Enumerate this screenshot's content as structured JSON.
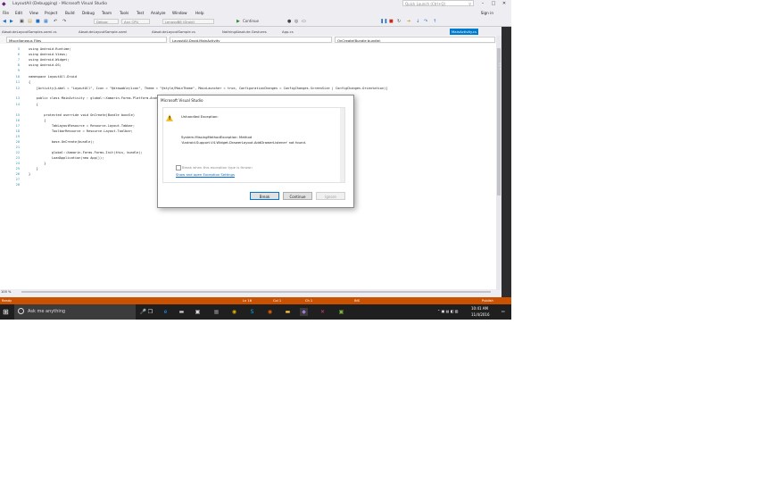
{
  "window": {
    "title": "LayoutAll (Debugging) - Microsoft Visual Studio",
    "quick_launch_placeholder": "Quick Launch (Ctrl+Q)",
    "sign_in": "Sign in"
  },
  "menu": [
    "File",
    "Edit",
    "View",
    "Project",
    "Build",
    "Debug",
    "Team",
    "Tools",
    "Test",
    "Analyze",
    "Window",
    "Help"
  ],
  "toolbar": {
    "config": "Debug",
    "platform": "Any CPU",
    "device": "LenovoB8 (Droid)",
    "continue_label": "Continue"
  },
  "doc_tabs": [
    {
      "label": "AbsoluteLayoutSamples.xaml.cs"
    },
    {
      "label": "AbsoluteLayoutSample.xaml"
    },
    {
      "label": "AbsoluteLayoutSample.cs"
    },
    {
      "label": "NothingAbsolute.Gestures"
    },
    {
      "label": "App.cs"
    },
    {
      "label": "MainActivity.cs"
    }
  ],
  "nav": {
    "project": "Miscellaneous Files",
    "type": "LayoutAll.Droid.MainActivity",
    "member": "OnCreate(Bundle bundle)"
  },
  "code_lines": [
    {
      "n": "5",
      "t": "using Android.Runtime;"
    },
    {
      "n": "6",
      "t": "using Android.Views;"
    },
    {
      "n": "7",
      "t": "using Android.Widget;"
    },
    {
      "n": "8",
      "t": "using Android.OS;"
    },
    {
      "n": "9",
      "t": ""
    },
    {
      "n": "10",
      "t": "namespace LayoutAll.Droid"
    },
    {
      "n": "11",
      "t": "{"
    },
    {
      "n": "12",
      "t": "    [Activity(Label = \"LayoutAll\", Icon = \"@drawable/icon\", Theme = \"@style/MainTheme\", MainLauncher = true, ConfigurationChanges = ConfigChanges.ScreenSize | ConfigChanges.Orientation)]"
    },
    {
      "n": "13",
      "t": "    public class MainActivity : global::Xamarin.Forms.Platform.Android.FormsAppCompatActivity"
    },
    {
      "n": "14",
      "t": "    {"
    },
    {
      "n": "15",
      "t": "        protected override void OnCreate(Bundle bundle)"
    },
    {
      "n": "16",
      "t": "        {"
    },
    {
      "n": "17",
      "t": "            TabLayoutResource = Resource.Layout.Tabbar;"
    },
    {
      "n": "18",
      "t": "            ToolbarResource = Resource.Layout.Toolbar;"
    },
    {
      "n": "19",
      "t": ""
    },
    {
      "n": "20",
      "t": "            base.OnCreate(bundle);"
    },
    {
      "n": "21",
      "t": ""
    },
    {
      "n": "22",
      "t": "            global::Xamarin.Forms.Forms.Init(this, bundle);"
    },
    {
      "n": "23",
      "t": "            LoadApplication(new App());"
    },
    {
      "n": "24",
      "t": "        }"
    },
    {
      "n": "25",
      "t": "    }"
    },
    {
      "n": "26",
      "t": "}"
    },
    {
      "n": "27",
      "t": ""
    },
    {
      "n": "28",
      "t": ""
    }
  ],
  "zoom": "100 %",
  "status": {
    "state": "Ready",
    "ln": "Ln 16",
    "col": "Col 1",
    "ch": "Ch 1",
    "ins": "INS",
    "publish": "Publish"
  },
  "dialog": {
    "title": "Microsoft Visual Studio",
    "heading": "Unhandled Exception:",
    "exception": "System.MissingMethodException: Method",
    "detail": "'Android.Support.V4.Widget.DrawerLayout.AddDrawerListener' not found.",
    "checkbox_label": "Break when this exception type is thrown",
    "link": "Show and open Exception Settings",
    "buttons": {
      "break": "Break",
      "continue": "Continue",
      "ignore": "Ignore"
    }
  },
  "taskbar": {
    "search_placeholder": "Ask me anything",
    "time": "10:41 AM",
    "date": "11/4/2016"
  },
  "colors": {
    "accent": "#007acc",
    "status_bar": "#ca5100",
    "vs_purple": "#68217a",
    "warning": "#f2c12e"
  }
}
